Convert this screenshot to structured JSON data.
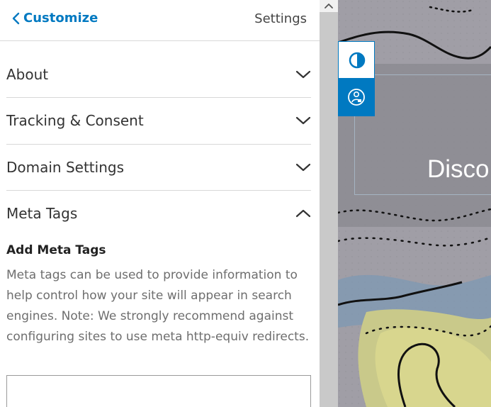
{
  "header": {
    "back_label": "Customize",
    "title": "Settings"
  },
  "sections": [
    {
      "label": "About",
      "expanded": false
    },
    {
      "label": "Tracking & Consent",
      "expanded": false
    },
    {
      "label": "Domain Settings",
      "expanded": false
    },
    {
      "label": "Meta Tags",
      "expanded": true
    }
  ],
  "meta_tags": {
    "heading": "Add Meta Tags",
    "description": "Meta tags can be used to provide information to help control how your site will appear in search engines. Note: We strongly recommend against configuring sites to use meta http-equiv redirects.",
    "input_value": ""
  },
  "preview": {
    "hero_text": "Disco",
    "buttons": [
      {
        "icon": "contrast-icon"
      },
      {
        "icon": "accessibility-icon"
      }
    ]
  },
  "colors": {
    "accent": "#0079c1",
    "text": "#333333",
    "muted_text": "#6e6e6e",
    "divider": "#d8d8d8"
  },
  "icons": [
    "chevron-left-icon",
    "chevron-down-icon",
    "chevron-up-icon",
    "contrast-icon",
    "accessibility-icon",
    "scroll-up-arrow-icon"
  ]
}
